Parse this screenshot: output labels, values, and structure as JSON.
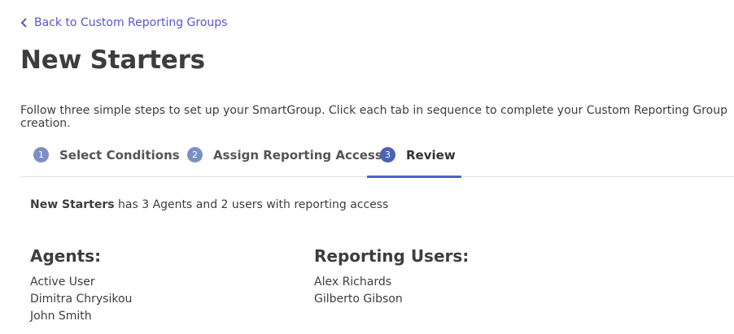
{
  "nav": {
    "back_label": "Back to Custom Reporting Groups"
  },
  "page": {
    "title": "New Starters",
    "intro": "Follow three simple steps to set up your SmartGroup. Click each tab in sequence to complete your Custom Reporting Group creation."
  },
  "tabs": [
    {
      "num": "1",
      "label": "Select Conditions",
      "active": false
    },
    {
      "num": "2",
      "label": "Assign Reporting Access",
      "active": false
    },
    {
      "num": "3",
      "label": "Review",
      "active": true
    }
  ],
  "summary": {
    "group_name": "New Starters",
    "text": " has 3 Agents and 2 users with reporting access"
  },
  "agents": {
    "heading": "Agents:",
    "items": [
      "Active User",
      "Dimitra Chrysikou",
      "John Smith"
    ]
  },
  "reporting_users": {
    "heading": "Reporting Users:",
    "items": [
      "Alex Richards",
      "Gilberto Gibson"
    ]
  },
  "colors": {
    "link": "#5757c8",
    "tab_active_underline": "#4b62c9",
    "tab_badge": "#7b8fc5",
    "tab_badge_active": "#4a63b5"
  }
}
